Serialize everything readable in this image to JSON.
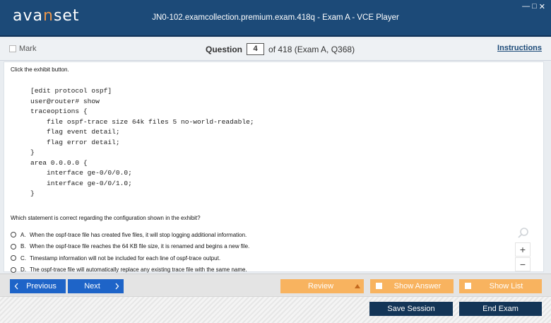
{
  "app": {
    "logo_prefix": "ava",
    "logo_accent": "n",
    "logo_suffix": "set",
    "window_title": "JN0-102.examcollection.premium.exam.418q - Exam A - VCE Player",
    "minimize_glyph": "—",
    "maximize_glyph": "□",
    "close_glyph": "✕"
  },
  "question_bar": {
    "mark_label": "Mark",
    "question_label": "Question",
    "question_number": "4",
    "of_text": "of 418 (Exam A, Q368)",
    "instructions_label": "Instructions"
  },
  "content": {
    "prompt": "Click the exhibit button.",
    "exhibit_lines": [
      "[edit protocol ospf]",
      "user@router# show",
      "traceoptions {",
      "    file ospf-trace size 64k files 5 no-world-readable;",
      "    flag event detail;",
      "    flag error detail;",
      "}",
      "area 0.0.0.0 {",
      "    interface ge-0/0/0.0;",
      "    interface ge-0/0/1.0;",
      "}"
    ],
    "question": "Which statement is correct regarding the configuration shown in the exhibit?",
    "answers": [
      {
        "letter": "A.",
        "text": "When the ospf-trace file has created five files, it will stop logging additional information."
      },
      {
        "letter": "B.",
        "text": "When the ospf-trace file reaches the 64 KB file size, it is renamed and begins a new file."
      },
      {
        "letter": "C.",
        "text": "Timestamp information will not be included for each line of ospf-trace output."
      },
      {
        "letter": "D.",
        "text": "The ospf-trace file will automatically replace any existing trace file with the same name."
      }
    ]
  },
  "zoom": {
    "plus": "+",
    "minus": "−"
  },
  "footer": {
    "previous_label": "Previous",
    "next_label": "Next",
    "review_label": "Review",
    "show_answer_label": "Show Answer",
    "show_list_label": "Show List",
    "save_session_label": "Save Session",
    "end_exam_label": "End Exam"
  },
  "colors": {
    "titlebar": "#1c4a78",
    "logo_accent": "#e9954b",
    "nav_blue": "#1e64c8",
    "orange": "#f8b35f",
    "navy": "#133557"
  }
}
